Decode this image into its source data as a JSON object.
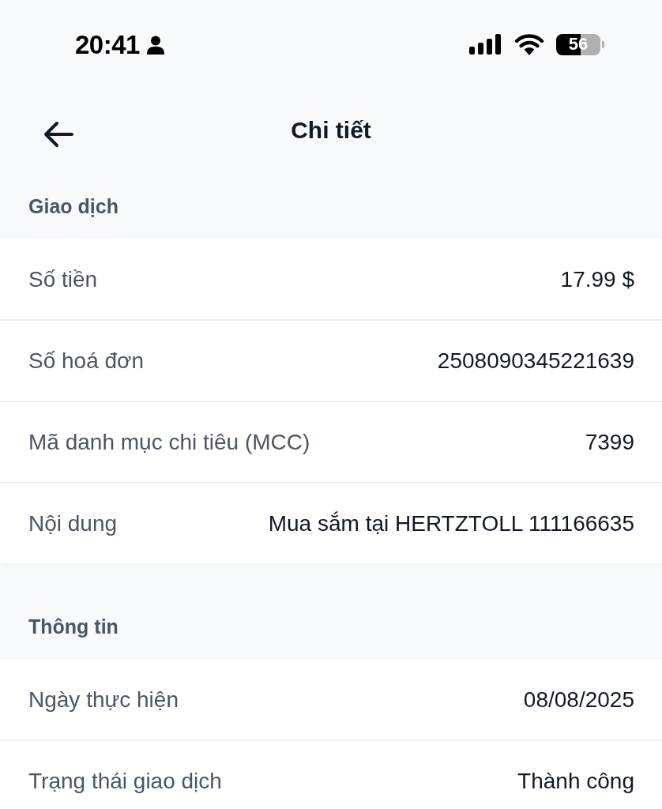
{
  "status_bar": {
    "time": "20:41",
    "battery": "56"
  },
  "header": {
    "title": "Chi tiết"
  },
  "sections": [
    {
      "title": "Giao dịch",
      "rows": [
        {
          "label": "Số tiền",
          "value": "17.99 $"
        },
        {
          "label": "Số hoá đơn",
          "value": "2508090345221639"
        },
        {
          "label": "Mã danh mục chi tiêu (MCC)",
          "value": "7399"
        },
        {
          "label": "Nội dung",
          "value": "Mua sắm tại HERTZTOLL 111166635"
        }
      ]
    },
    {
      "title": "Thông tin",
      "rows": [
        {
          "label": "Ngày thực hiện",
          "value": "08/08/2025"
        },
        {
          "label": "Trạng thái giao dịch",
          "value": "Thành công"
        }
      ]
    }
  ]
}
